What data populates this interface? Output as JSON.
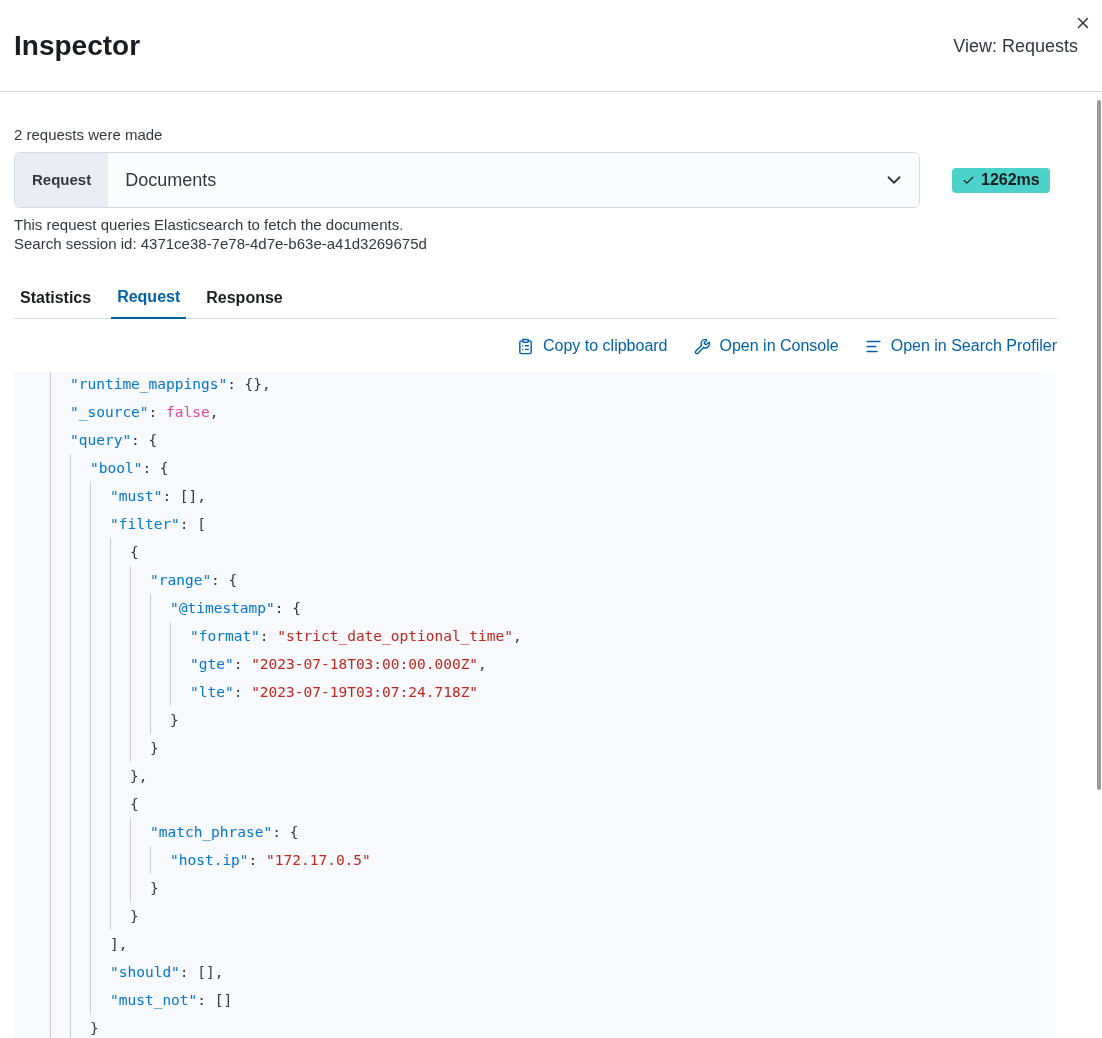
{
  "flyout": {
    "title": "Inspector",
    "view_menu": "View: Requests"
  },
  "summary": "2 requests were made",
  "request_select": {
    "prepend": "Request",
    "value": "Documents"
  },
  "status_badge": {
    "text": "1262ms"
  },
  "description": "This request queries Elasticsearch to fetch the documents.",
  "session_id": "Search session id: 4371ce38-7e78-4d7e-b63e-a41d3269675d",
  "tabs": [
    {
      "label": "Statistics",
      "selected": false
    },
    {
      "label": "Request",
      "selected": true
    },
    {
      "label": "Response",
      "selected": false
    }
  ],
  "actions": [
    {
      "kind": "copy",
      "label": "Copy to clipboard"
    },
    {
      "kind": "console",
      "label": "Open in Console"
    },
    {
      "kind": "profiler",
      "label": "Open in Search Profiler"
    }
  ],
  "code_lines": [
    {
      "tokens": [
        {
          "kind": "key",
          "text": "\"runtime_mappings\""
        },
        {
          "kind": "punct",
          "text": ": {},"
        }
      ]
    },
    {
      "tokens": [
        {
          "kind": "key",
          "text": "\"_source\""
        },
        {
          "kind": "punct",
          "text": ": "
        },
        {
          "kind": "bool",
          "text": "false"
        },
        {
          "kind": "punct",
          "text": ","
        }
      ]
    },
    {
      "tokens": [
        {
          "kind": "key",
          "text": "\"query\""
        },
        {
          "kind": "punct",
          "text": ": {"
        }
      ],
      "children": [
        {
          "tokens": [
            {
              "kind": "key",
              "text": "\"bool\""
            },
            {
              "kind": "punct",
              "text": ": {"
            }
          ],
          "children": [
            {
              "tokens": [
                {
                  "kind": "key",
                  "text": "\"must\""
                },
                {
                  "kind": "punct",
                  "text": ": [],"
                }
              ]
            },
            {
              "tokens": [
                {
                  "kind": "key",
                  "text": "\"filter\""
                },
                {
                  "kind": "punct",
                  "text": ": ["
                }
              ],
              "children": [
                {
                  "tokens": [
                    {
                      "kind": "punct",
                      "text": "{"
                    }
                  ],
                  "children": [
                    {
                      "tokens": [
                        {
                          "kind": "key",
                          "text": "\"range\""
                        },
                        {
                          "kind": "punct",
                          "text": ": {"
                        }
                      ],
                      "children": [
                        {
                          "tokens": [
                            {
                              "kind": "key",
                              "text": "\"@timestamp\""
                            },
                            {
                              "kind": "punct",
                              "text": ": {"
                            }
                          ],
                          "children": [
                            {
                              "tokens": [
                                {
                                  "kind": "key",
                                  "text": "\"format\""
                                },
                                {
                                  "kind": "punct",
                                  "text": ": "
                                },
                                {
                                  "kind": "string",
                                  "text": "\"strict_date_optional_time\""
                                },
                                {
                                  "kind": "punct",
                                  "text": ","
                                }
                              ]
                            },
                            {
                              "tokens": [
                                {
                                  "kind": "key",
                                  "text": "\"gte\""
                                },
                                {
                                  "kind": "punct",
                                  "text": ": "
                                },
                                {
                                  "kind": "string",
                                  "text": "\"2023-07-18T03:00:00.000Z\""
                                },
                                {
                                  "kind": "punct",
                                  "text": ","
                                }
                              ]
                            },
                            {
                              "tokens": [
                                {
                                  "kind": "key",
                                  "text": "\"lte\""
                                },
                                {
                                  "kind": "punct",
                                  "text": ": "
                                },
                                {
                                  "kind": "string",
                                  "text": "\"2023-07-19T03:07:24.718Z\""
                                }
                              ]
                            }
                          ],
                          "close": "}"
                        }
                      ],
                      "close": "}"
                    }
                  ],
                  "close": "},"
                },
                {
                  "tokens": [
                    {
                      "kind": "punct",
                      "text": "{"
                    }
                  ],
                  "children": [
                    {
                      "tokens": [
                        {
                          "kind": "key",
                          "text": "\"match_phrase\""
                        },
                        {
                          "kind": "punct",
                          "text": ": {"
                        }
                      ],
                      "children": [
                        {
                          "tokens": [
                            {
                              "kind": "key",
                              "text": "\"host.ip\""
                            },
                            {
                              "kind": "punct",
                              "text": ": "
                            },
                            {
                              "kind": "string",
                              "text": "\"172.17.0.5\""
                            }
                          ]
                        }
                      ],
                      "close": "}"
                    }
                  ],
                  "close": "}"
                }
              ],
              "close": "],"
            },
            {
              "tokens": [
                {
                  "kind": "key",
                  "text": "\"should\""
                },
                {
                  "kind": "punct",
                  "text": ": [],"
                }
              ]
            },
            {
              "tokens": [
                {
                  "kind": "key",
                  "text": "\"must_not\""
                },
                {
                  "kind": "punct",
                  "text": ": []"
                }
              ]
            }
          ],
          "close": "}"
        }
      ]
    }
  ]
}
